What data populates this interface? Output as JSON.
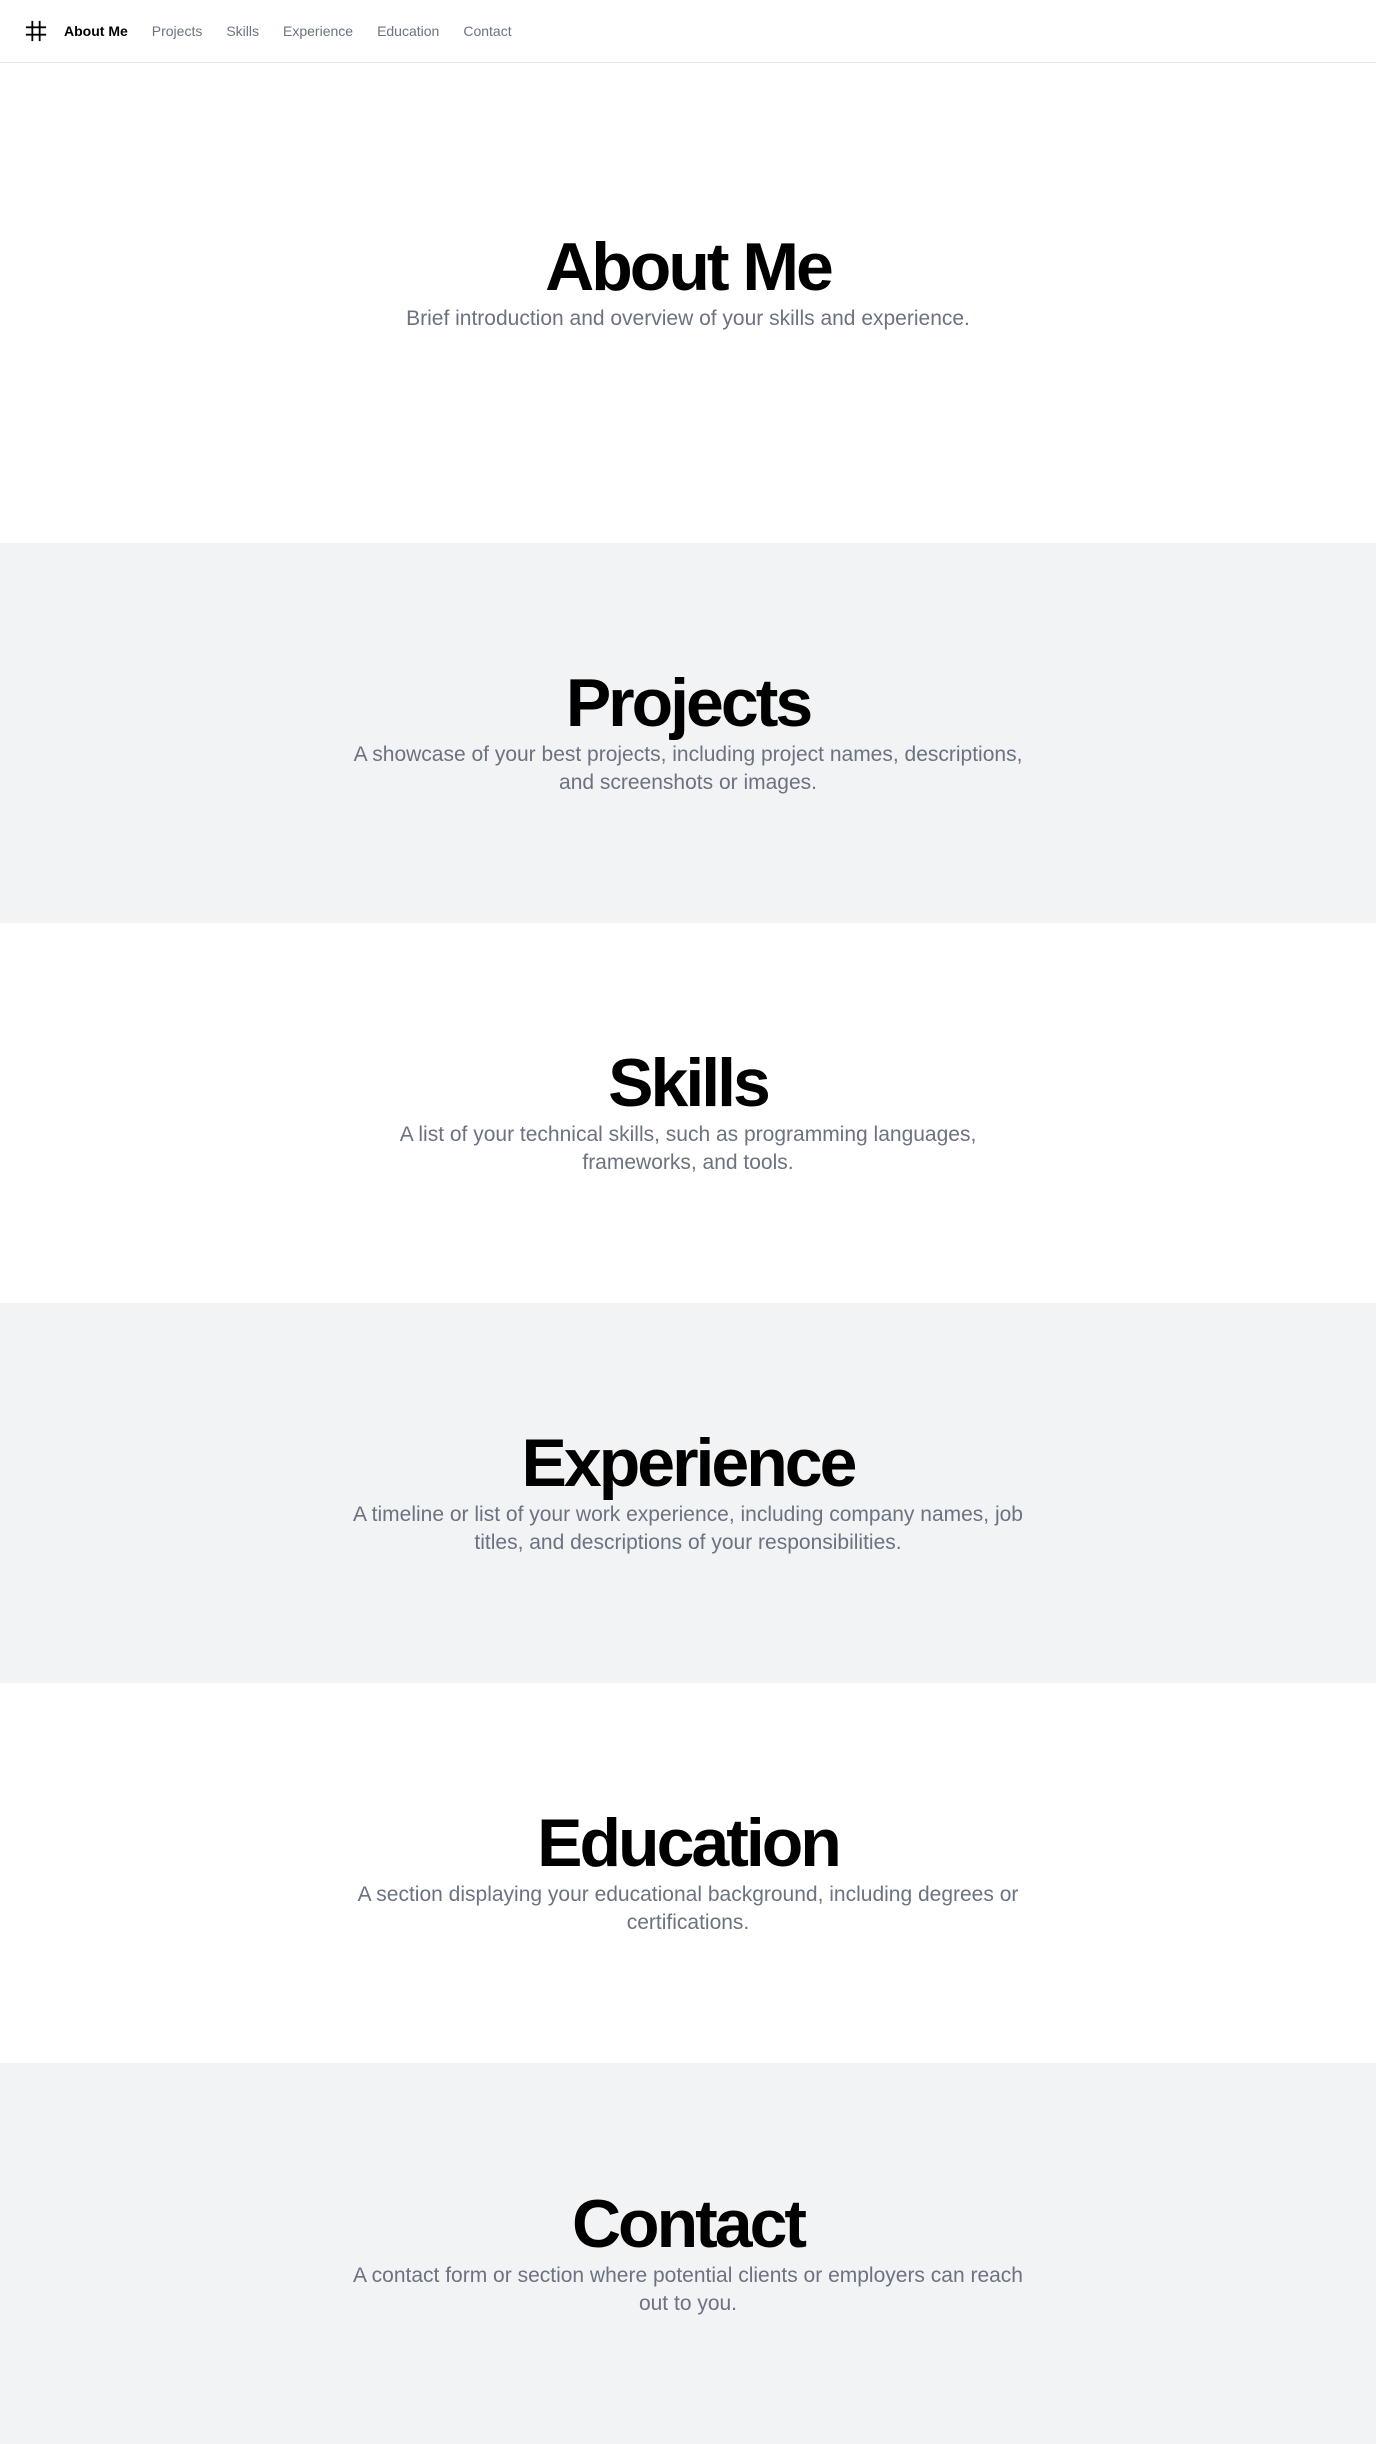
{
  "nav": {
    "logo_icon": "hash-icon",
    "links": [
      {
        "label": "About Me",
        "active": true
      },
      {
        "label": "Projects",
        "active": false
      },
      {
        "label": "Skills",
        "active": false
      },
      {
        "label": "Experience",
        "active": false
      },
      {
        "label": "Education",
        "active": false
      },
      {
        "label": "Contact",
        "active": false
      }
    ]
  },
  "sections": {
    "about": {
      "title": "About Me",
      "description": "Brief introduction and overview of your skills and experience."
    },
    "projects": {
      "title": "Projects",
      "description": "A showcase of your best projects, including project names, descriptions, and screenshots or images."
    },
    "skills": {
      "title": "Skills",
      "description": "A list of your technical skills, such as programming languages, frameworks, and tools."
    },
    "experience": {
      "title": "Experience",
      "description": "A timeline or list of your work experience, including company names, job titles, and descriptions of your responsibilities."
    },
    "education": {
      "title": "Education",
      "description": "A section displaying your educational background, including degrees or certifications."
    },
    "contact": {
      "title": "Contact",
      "description": "A contact form or section where potential clients or employers can reach out to you."
    }
  },
  "colors": {
    "text_primary": "#000000",
    "text_muted": "#6b7280",
    "section_alt_bg": "#f2f3f5",
    "border": "#e5e7eb"
  }
}
